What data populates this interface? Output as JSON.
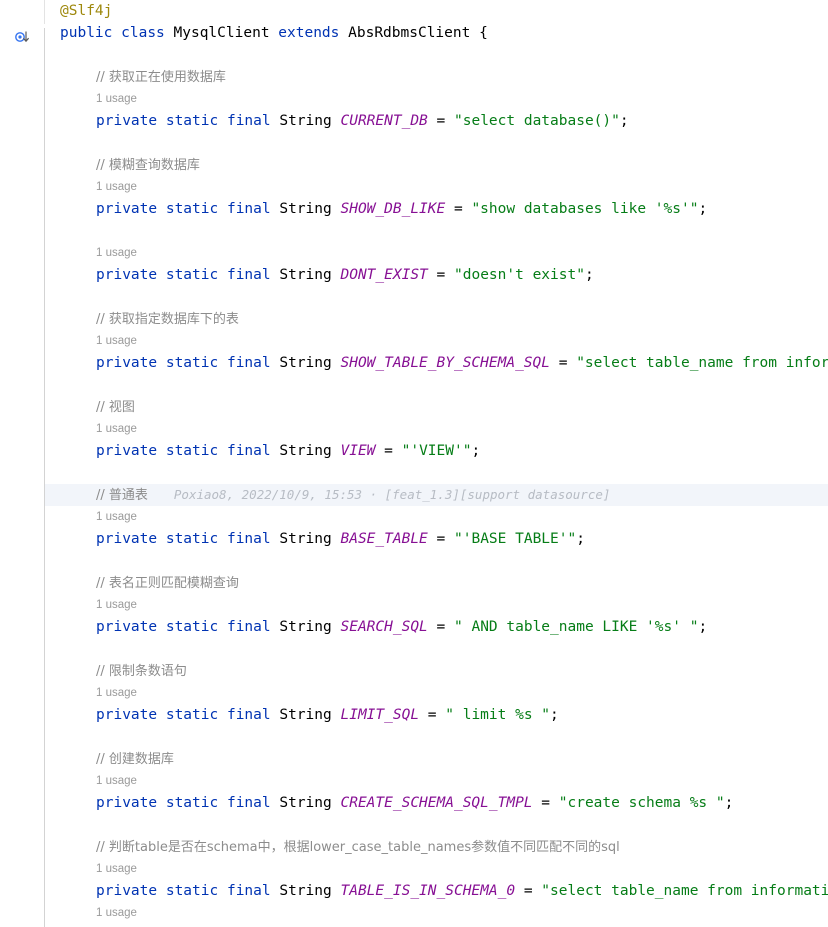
{
  "editor": {
    "language": "java",
    "theme": "light",
    "class_name": "MysqlClient",
    "super_class": "AbsRdbmsClient",
    "colors": {
      "background": "#ffffff",
      "keyword": "#0033b3",
      "string": "#067d17",
      "constant": "#871094",
      "comment": "#8c8c8c",
      "annotation": "#9e880d",
      "caret_row": "#f2f5fa",
      "blame_text": "#b7bcc4",
      "gutter_icon": "#3574f0"
    },
    "gutter": {
      "icons": [
        {
          "name": "implementing-method-icon",
          "line": 2,
          "tooltip": "Implements method"
        }
      ]
    }
  },
  "blame": {
    "author": "Poxiao8",
    "date": "2022/10/9",
    "time": "15:53",
    "separator": "·",
    "message": "[feat_1.3][support datasource]",
    "full": "Poxiao8, 2022/10/9, 15:53 · [feat_1.3][support datasource]"
  },
  "hints": {
    "one_usage": "1 usage"
  },
  "code": {
    "annotation_slf4j": "@Slf4j",
    "class_decl": {
      "kw_public": "public",
      "kw_class": "class",
      "name": "MysqlClient",
      "kw_extends": "extends",
      "super": "AbsRdbmsClient",
      "brace": "{"
    },
    "modifiers": {
      "private": "private",
      "static": "static",
      "final": "final",
      "type_string": "String",
      "assign": "=",
      "semi": ";"
    },
    "fields": [
      {
        "comment": "// 获取正在使用数据库",
        "usage": "1 usage",
        "name": "CURRENT_DB",
        "value": "\"select database()\""
      },
      {
        "comment": "// 模糊查询数据库",
        "usage": "1 usage",
        "name": "SHOW_DB_LIKE",
        "value": "\"show databases like '%s'\""
      },
      {
        "comment": "",
        "usage": "1 usage",
        "name": "DONT_EXIST",
        "value": "\"doesn't exist\""
      },
      {
        "comment": "// 获取指定数据库下的表",
        "usage": "1 usage",
        "name": "SHOW_TABLE_BY_SCHEMA_SQL",
        "value": "\"select table_name from information_sch"
      },
      {
        "comment": "// 视图",
        "usage": "1 usage",
        "name": "VIEW",
        "value": "\"'VIEW'\""
      },
      {
        "comment": "// 普通表",
        "usage": "1 usage",
        "name": "BASE_TABLE",
        "value": "\"'BASE TABLE'\"",
        "highlighted": true
      },
      {
        "comment": "// 表名正则匹配模糊查询",
        "usage": "1 usage",
        "name": "SEARCH_SQL",
        "value": "\" AND table_name LIKE '%s' \""
      },
      {
        "comment": "// 限制条数语句",
        "usage": "1 usage",
        "name": "LIMIT_SQL",
        "value": "\" limit %s \""
      },
      {
        "comment": "// 创建数据库",
        "usage": "1 usage",
        "name": "CREATE_SCHEMA_SQL_TMPL",
        "value": "\"create schema %s \""
      },
      {
        "comment": "// 判断table是否在schema中，根据lower_case_table_names参数值不同匹配不同的sql",
        "usage": "1 usage",
        "name": "TABLE_IS_IN_SCHEMA_0",
        "value": "\"select table_name from information_schema."
      }
    ],
    "trailing_usage": "1 usage"
  }
}
